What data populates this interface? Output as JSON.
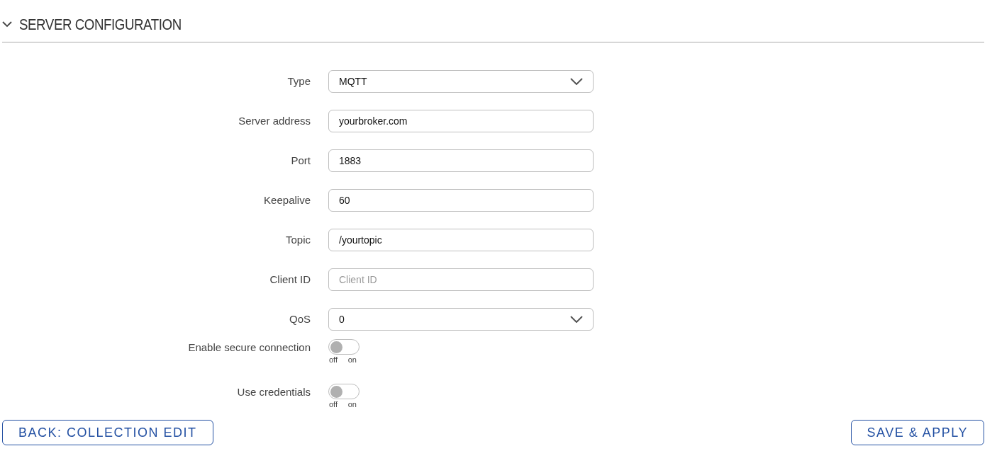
{
  "section": {
    "title": "SERVER CONFIGURATION",
    "expanded": true
  },
  "fields": [
    {
      "kind": "select",
      "label": "Type",
      "value": "MQTT"
    },
    {
      "kind": "text",
      "label": "Server address",
      "value": "yourbroker.com"
    },
    {
      "kind": "text",
      "label": "Port",
      "value": "1883"
    },
    {
      "kind": "text",
      "label": "Keepalive",
      "value": "60"
    },
    {
      "kind": "text",
      "label": "Topic",
      "value": "/yourtopic"
    },
    {
      "kind": "text",
      "label": "Client ID",
      "placeholder": "Client ID"
    },
    {
      "kind": "select",
      "label": "QoS",
      "value": "0"
    },
    {
      "kind": "toggle",
      "label": "Enable secure connection",
      "on": false,
      "off_label": "off",
      "on_label": "on"
    },
    {
      "kind": "toggle",
      "label": "Use credentials",
      "on": false,
      "off_label": "off",
      "on_label": "on"
    }
  ],
  "buttons": {
    "back": "BACK: COLLECTION EDIT",
    "save": "SAVE & APPLY"
  }
}
